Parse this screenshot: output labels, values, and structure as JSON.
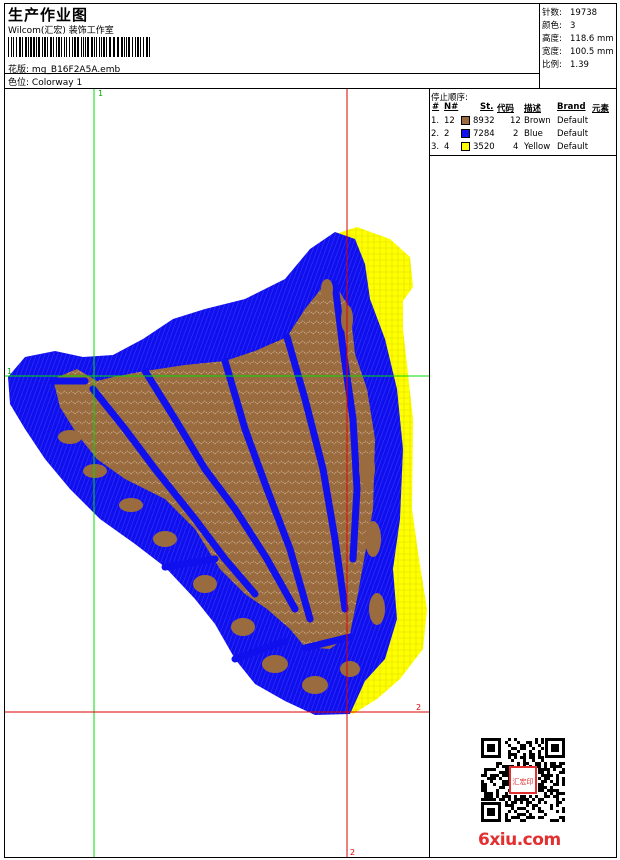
{
  "header": {
    "title": "生产作业图",
    "company": "Wilcom(汇宏) 装饰工作室",
    "design_label": "花版:",
    "design_value": "mg_B16F2A5A.emb",
    "colorway_label": "色位:",
    "colorway_value": "Colorway 1"
  },
  "stats": [
    {
      "label": "针数:",
      "value": "19738"
    },
    {
      "label": "颜色:",
      "value": "3"
    },
    {
      "label": "高度:",
      "value": "118.6 mm"
    },
    {
      "label": "宽度:",
      "value": "100.5 mm"
    },
    {
      "label": "比例:",
      "value": "1.39"
    }
  ],
  "stop_sequence": {
    "label": "停止顺序:",
    "headers": [
      "#",
      "N#",
      "St.",
      "代码",
      "描述",
      "Brand",
      "元素"
    ],
    "rows": [
      {
        "idx": "1.",
        "n": "12",
        "color": "#9a6b3f",
        "st": "8932",
        "code": "12",
        "desc": "Brown",
        "brand": "Default"
      },
      {
        "idx": "2.",
        "n": "2",
        "color": "#1010ee",
        "st": "7284",
        "code": "2",
        "desc": "Blue",
        "brand": "Default"
      },
      {
        "idx": "3.",
        "n": "4",
        "color": "#ffff00",
        "st": "3520",
        "code": "4",
        "desc": "Yellow",
        "brand": "Default"
      }
    ]
  },
  "guides": {
    "green_v_label": "1",
    "green_h_label": "1",
    "red_v_label": "2",
    "red_h_label": "2"
  },
  "colors": {
    "brown": "#9a6b3f",
    "blue": "#1010ee",
    "yellow": "#ffff00",
    "guide_green": "#00dd00",
    "guide_red": "#dd0000"
  },
  "watermark": "6xiu.com",
  "seal_text": "汇宏印"
}
